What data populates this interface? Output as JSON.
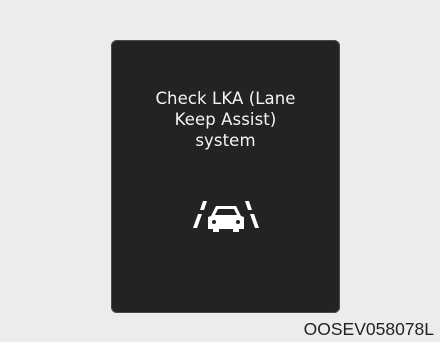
{
  "display": {
    "message_lines": [
      "Check LKA (Lane",
      "Keep Assist)",
      "system"
    ],
    "icon": "lane-keep-assist-icon",
    "background_color": "#232323",
    "text_color": "#f4f4f4"
  },
  "image_code": "OOSEV058078L"
}
